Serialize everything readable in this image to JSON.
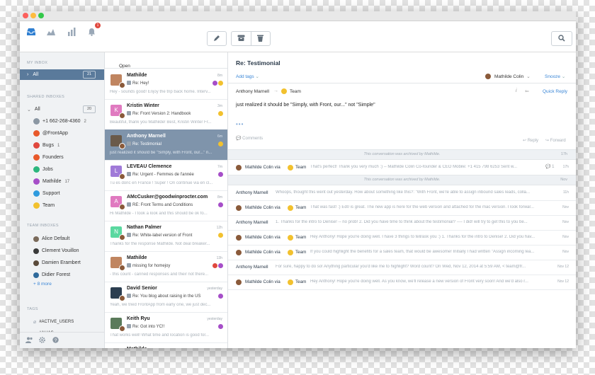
{
  "colors": {
    "accent": "#3a86d6",
    "sidebar_active": "#5a7a9b",
    "selected_row": "#7f94ab",
    "notification": "#e0483e",
    "team_yellow": "#f2c12e"
  },
  "toolbar": {
    "notification_count": "1",
    "icons": [
      "inbox-icon",
      "analytics-icon",
      "bar-chart-icon",
      "bell-icon",
      "compose-icon",
      "archive-icon",
      "trash-icon",
      "search-icon"
    ]
  },
  "sidebar": {
    "my_inbox_label": "MY INBOX",
    "all_label": "All",
    "all_count": "21",
    "shared_inboxes_label": "SHARED INBOXES",
    "shared_all_label": "All",
    "shared_all_count": "20",
    "shared_items": [
      {
        "label": "+1 662-268-4360",
        "count": "2",
        "color": "#8b97a3"
      },
      {
        "label": "@FrontApp",
        "count": "",
        "color": "#e8592b"
      },
      {
        "label": "Bugs",
        "count": "1",
        "color": "#e0483e"
      },
      {
        "label": "Founders",
        "count": "",
        "color": "#e8592b"
      },
      {
        "label": "Jobs",
        "count": "",
        "color": "#2cb67d"
      },
      {
        "label": "Mathilde",
        "count": "17",
        "color": "#a64ec8"
      },
      {
        "label": "Support",
        "count": "",
        "color": "#2f9bde"
      },
      {
        "label": "Team",
        "count": "",
        "color": "#f2c12e"
      }
    ],
    "team_inboxes_label": "TEAM INBOXES",
    "team_items": [
      {
        "label": "Alice Default",
        "color": "#7a6a5a"
      },
      {
        "label": "Clement Vouillon",
        "color": "#3a3a3a"
      },
      {
        "label": "Damien Erambert",
        "color": "#5a4a3a"
      },
      {
        "label": "Didier Forest",
        "color": "#2f6a9b"
      }
    ],
    "more_label": "+ 8 more",
    "tags_label": "TAGS",
    "tags": [
      "#ACTIVE_USERS",
      "#ALIAS"
    ]
  },
  "list": {
    "filter_label": "Open",
    "conversations": [
      {
        "name": "Mathilde",
        "subject": "Re: Hey!",
        "preview": "Hey - sounds good! Enjoy the trip back home. Interv...",
        "time": "8m",
        "pic_color": "#c08560",
        "initial": "",
        "tags": [
          "#a64ec8",
          "#f2c12e"
        ]
      },
      {
        "name": "Kristin Winter",
        "subject": "Re: Front Version 2: Handbook",
        "preview": "Beautiful, thank you Mathilde! Best, Kristin Winter Fr...",
        "time": "3m",
        "pic_color": "#e07ac0",
        "initial": "K",
        "tags": [
          "#f2c12e"
        ]
      },
      {
        "name": "Anthony Marnell",
        "subject": "Re: Testimonial",
        "preview": "just realized it should be \"Simply, with Front, our...\" n...",
        "time": "6m",
        "pic_color": "#6a5a4a",
        "initial": "",
        "tags": [
          "#f2c12e"
        ]
      },
      {
        "name": "LEVEAU Clemence",
        "subject": "Re: Urgent - Femmes de l'année",
        "preview": "Tu es donc en France ! Super ! On continue via en cl...",
        "time": "7m",
        "pic_color": "#a07ad8",
        "initial": "L",
        "tags": [
          "#a64ec8"
        ]
      },
      {
        "name": "AMcCusker@goodwinprocter.com",
        "subject": "RE: Front Terms and Conditions",
        "preview": "Hi Mathilde - I took a look and this should be ok fo...",
        "time": "8m",
        "pic_color": "#e07ac0",
        "initial": "A",
        "tags": [
          "#a64ec8"
        ]
      },
      {
        "name": "Nathan Palmer",
        "subject": "Re: White-label version of Front",
        "preview": "Thanks for the response Mathilde. Not deal breaker...",
        "time": "12h",
        "pic_color": "#5ad8a0",
        "initial": "N",
        "tags": [
          "#f2c12e"
        ]
      },
      {
        "name": "Mathilde",
        "subject": "missing for homejoy",
        "preview": "- this count - canned responses and their not there...",
        "time": "13h",
        "pic_color": "#c08560",
        "initial": "",
        "tags": [
          "#e0483e",
          "#a64ec8"
        ]
      },
      {
        "name": "David Senior",
        "subject": "Re: You blog about raising in the US",
        "preview": "Yeah, we tried FrontApp from early one, we just dec...",
        "time": "yesterday",
        "pic_color": "#2c3e50",
        "initial": "",
        "tags": [
          "#a64ec8"
        ]
      },
      {
        "name": "Keith Ryu",
        "subject": "Re: Got into YC!!",
        "preview": "That works well! What time and location is good for...",
        "time": "yesterday",
        "pic_color": "#5a7a5a",
        "initial": "",
        "tags": [
          "#a64ec8"
        ]
      },
      {
        "name": "Mathilde",
        "subject": "",
        "preview": "",
        "time": "",
        "pic_color": "#c08560",
        "initial": "",
        "tags": []
      }
    ]
  },
  "main": {
    "title": "Re: Testimonial",
    "add_tags": "Add tags",
    "assignee": "Mathilde Colin",
    "snooze": "Snooze",
    "message": {
      "from": "Anthony Marnell",
      "to": "Team",
      "quick_reply": "Quick Reply",
      "body": "just realized it should be \"Simply, with Front, our...\" not \"Simple\"",
      "dots": "•••",
      "comments": "Comments",
      "reply": "Reply",
      "forward": "Forward"
    },
    "rows": [
      {
        "kind": "archived",
        "text": "This conversation was archived by Mathilde.",
        "time": "17h"
      },
      {
        "kind": "msg",
        "avatar": true,
        "from": "Mathilde Colin via",
        "team": "Team",
        "preview": "That's perfect! Thank you very much :) -- Mathilde Colin Co-founder & CEO Mobile: +1 415 798 6253 Sent w...",
        "comments": "1",
        "time": "17h"
      },
      {
        "kind": "archived",
        "text": "This conversation was archived by Mathilde.",
        "time": "Nov"
      },
      {
        "kind": "msg",
        "avatar": false,
        "from": "Anthony Marnell",
        "team": "",
        "preview": "Whoops, thought this went out yesterday. How about something like this?: \"With Front, we're able to assign inbound sales leads, colla...",
        "comments": "",
        "time": "11h"
      },
      {
        "kind": "msg",
        "avatar": true,
        "from": "Mathilde Colin via",
        "team": "Team",
        "preview": "That was fast! :) Ed0 is great. The new app is here for the web version and attached for the mac version. I look forwar...",
        "comments": "",
        "time": "Nov"
      },
      {
        "kind": "msg",
        "avatar": false,
        "from": "Anthony Marnell",
        "team": "",
        "preview": "1. Thanks for the intro to Denise! -- no prob! 2. Did you have time to think about the testimonial? ---- I did! will try to get this to you be...",
        "comments": "",
        "time": "Nov"
      },
      {
        "kind": "msg",
        "avatar": true,
        "from": "Mathilde Colin via",
        "team": "Team",
        "preview": "Hey Anthony! Hope you're doing well. I have 3 things to tell/ask you :) 1. Thanks for the intro to Denise! 2. Did you hav...",
        "comments": "",
        "time": "Nov"
      },
      {
        "kind": "msg",
        "avatar": true,
        "from": "Mathilde Colin via",
        "team": "Team",
        "preview": "If you could highlight the benefits for a sales team, that would be awesome! Initially I had written \"Assign incoming lea...",
        "comments": "",
        "time": "Nov"
      },
      {
        "kind": "msg",
        "avatar": false,
        "from": "Anthony Marnell",
        "team": "",
        "preview": "For sure, happy to do so! Anything particular you'd like me to highlight? Word count? On Wed, Nov 12, 2014 at 5:59 AM, < team@fr...",
        "comments": "",
        "time": "Nov 12"
      },
      {
        "kind": "msg",
        "avatar": true,
        "from": "Mathilde Colin via",
        "team": "Team",
        "preview": "Hey Anthony! Hope you're doing well. As you know, we'll release a new version of Front very soon! And we'd also r...",
        "comments": "",
        "time": "Nov 12"
      }
    ]
  }
}
